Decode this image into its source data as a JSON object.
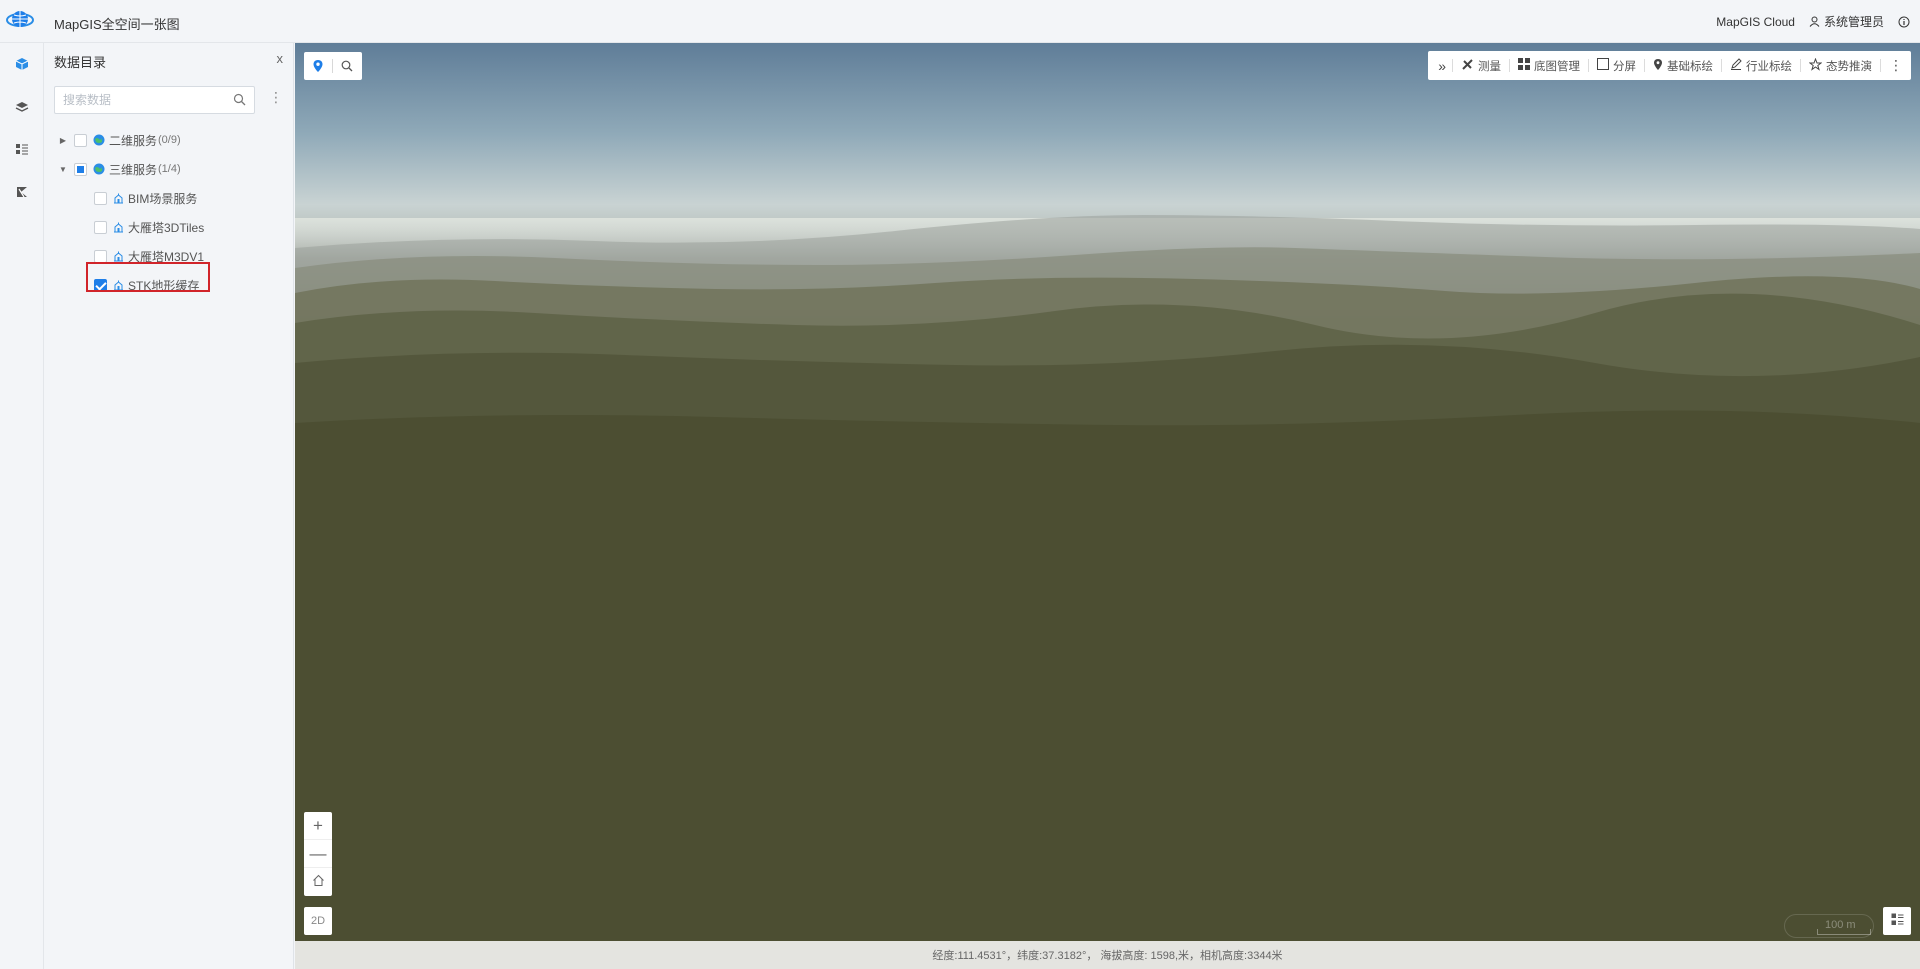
{
  "header": {
    "app_title": "MapGIS全空间一张图",
    "cloud_link": "MapGIS Cloud",
    "user_name": "系统管理员"
  },
  "rail": {
    "items": [
      {
        "icon": "cube-icon",
        "active": true
      },
      {
        "icon": "layers-icon",
        "active": false
      },
      {
        "icon": "legend-icon",
        "active": false
      },
      {
        "icon": "analysis-icon",
        "active": false
      }
    ]
  },
  "catalog": {
    "title": "数据目录",
    "close": "x",
    "search_placeholder": "搜索数据",
    "more": "⋮",
    "nodes": [
      {
        "label": "二维服务",
        "count": "(0/9)",
        "expanded": false,
        "state": "unchecked"
      },
      {
        "label": "三维服务",
        "count": "(1/4)",
        "expanded": true,
        "state": "partial",
        "children": [
          {
            "label": "BIM场景服务",
            "state": "unchecked"
          },
          {
            "label": "大雁塔3DTiles",
            "state": "unchecked"
          },
          {
            "label": "大雁塔M3DV1",
            "state": "unchecked"
          },
          {
            "label": "STK地形缓存",
            "state": "checked"
          }
        ]
      }
    ]
  },
  "toolbar": {
    "collapse": "»",
    "items": [
      {
        "label": "测量",
        "icon": "ruler-icon"
      },
      {
        "label": "底图管理",
        "icon": "grid-icon"
      },
      {
        "label": "分屏",
        "icon": "split-screen-icon"
      },
      {
        "label": "基础标绘",
        "icon": "pin-icon"
      },
      {
        "label": "行业标绘",
        "icon": "pen-icon"
      },
      {
        "label": "态势推演",
        "icon": "star-icon"
      }
    ],
    "more": "⋮"
  },
  "map_controls": {
    "zoom_in": "+",
    "zoom_out": "—",
    "view_2d": "2D",
    "scale_label": "100 m"
  },
  "status": {
    "text": "经度:111.4531°，纬度:37.3182°， 海拔高度: 1598,米，相机高度:3344米"
  },
  "colors": {
    "accent": "#1e7ee8",
    "highlight_box": "#d1242a"
  }
}
